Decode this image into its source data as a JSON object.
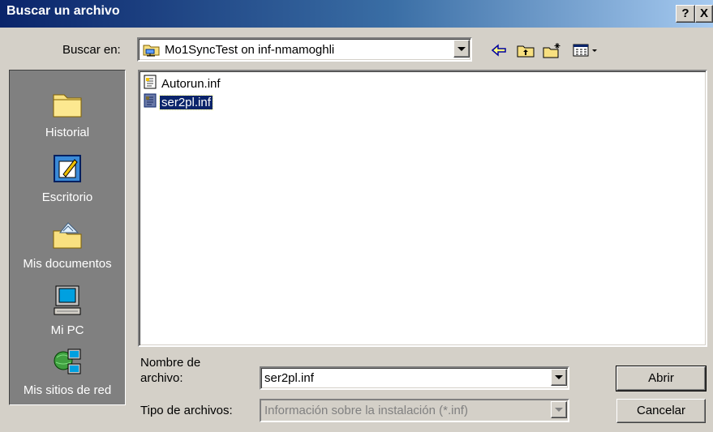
{
  "window": {
    "title": "Buscar un archivo",
    "help_btn": "?",
    "close_btn": "X"
  },
  "lookin": {
    "label": "Buscar en:",
    "value": "Mo1SyncTest on inf-nmamoghli"
  },
  "toolbar": {
    "back": "back-icon",
    "up": "up-folder-icon",
    "new_folder": "new-folder-icon",
    "view_menu": "view-menu-icon"
  },
  "places": [
    {
      "label": "Historial",
      "icon": "history-folder-icon"
    },
    {
      "label": "Escritorio",
      "icon": "desktop-icon"
    },
    {
      "label": "Mis documentos",
      "icon": "my-documents-icon"
    },
    {
      "label": "Mi PC",
      "icon": "my-computer-icon"
    },
    {
      "label": "Mis sitios de red",
      "icon": "network-places-icon"
    }
  ],
  "files": [
    {
      "name": "Autorun.inf",
      "selected": false
    },
    {
      "name": "ser2pl.inf",
      "selected": true
    }
  ],
  "filename": {
    "label": "Nombre de archivo:",
    "label_line1": "Nombre de",
    "label_line2": "archivo:",
    "value": "ser2pl.inf"
  },
  "filetype": {
    "label": "Tipo de archivos:",
    "value": "Información sobre la instalación (*.inf)"
  },
  "buttons": {
    "open": "Abrir",
    "cancel": "Cancelar"
  },
  "colors": {
    "title_start": "#0a246a",
    "title_end": "#a6caf0",
    "face": "#d4d0c8",
    "places_bg": "#808080",
    "selection": "#0a246a"
  }
}
